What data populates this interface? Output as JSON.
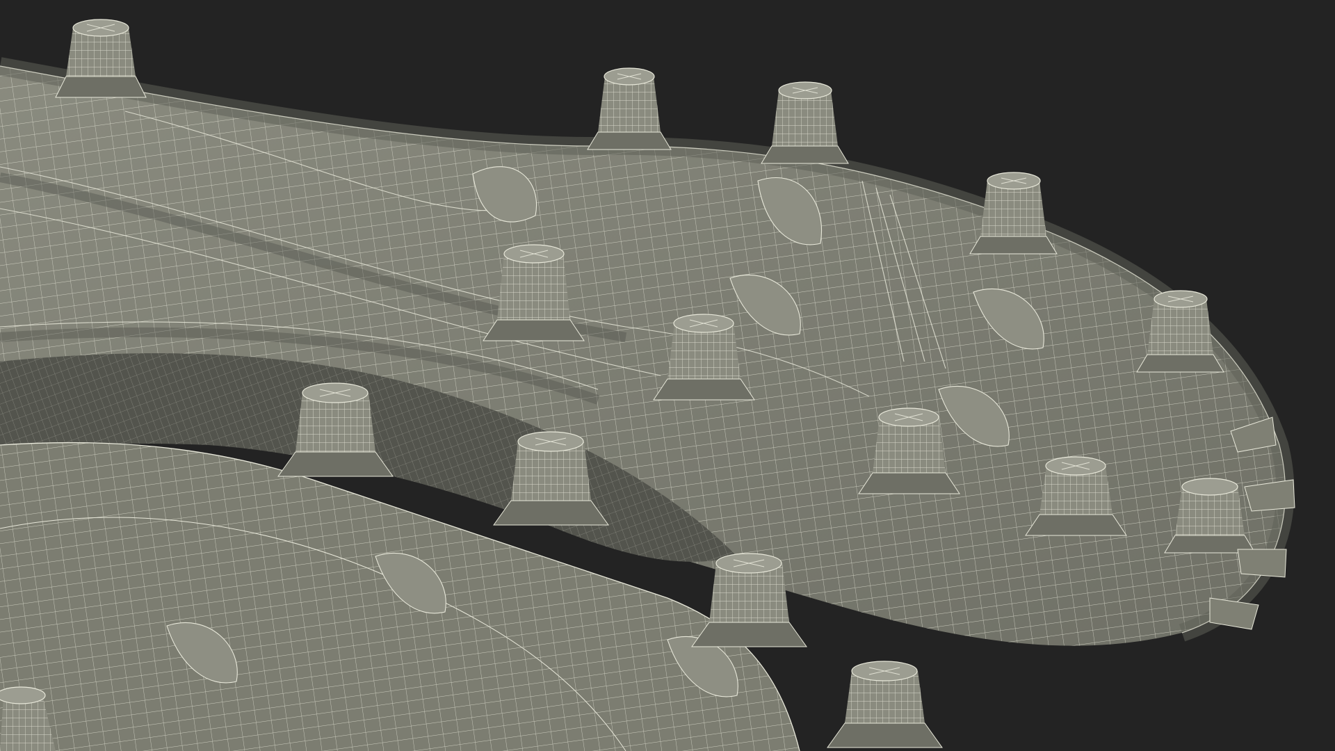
{
  "scene": {
    "subject": "cleat-sole-wireframe",
    "colors": {
      "background": "#232323",
      "surface": "#7f8074",
      "surface_dark": "#5f6058",
      "surface_light": "#9a9b8f",
      "wire": "#e8e8da"
    }
  }
}
